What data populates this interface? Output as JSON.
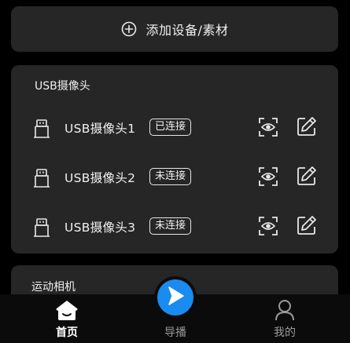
{
  "add_device": {
    "label": "添加设备/素材",
    "icon": "plus-circle-icon"
  },
  "usb_section": {
    "title": "USB摄像头",
    "cameras": [
      {
        "name": "USB摄像头1",
        "status": "已连接"
      },
      {
        "name": "USB摄像头2",
        "status": "未连接"
      },
      {
        "name": "USB摄像头3",
        "status": "未连接"
      }
    ]
  },
  "action_section": {
    "title": "运动相机"
  },
  "tabbar": {
    "home_label": "首页",
    "live_label": "导播",
    "mine_label": "我的",
    "active_tab": "首页"
  },
  "colors": {
    "background": "#000000",
    "card": "#262626",
    "accent": "#1a8bf0",
    "text": "#f0f0f0",
    "inactive_text": "#9a9a9a"
  }
}
